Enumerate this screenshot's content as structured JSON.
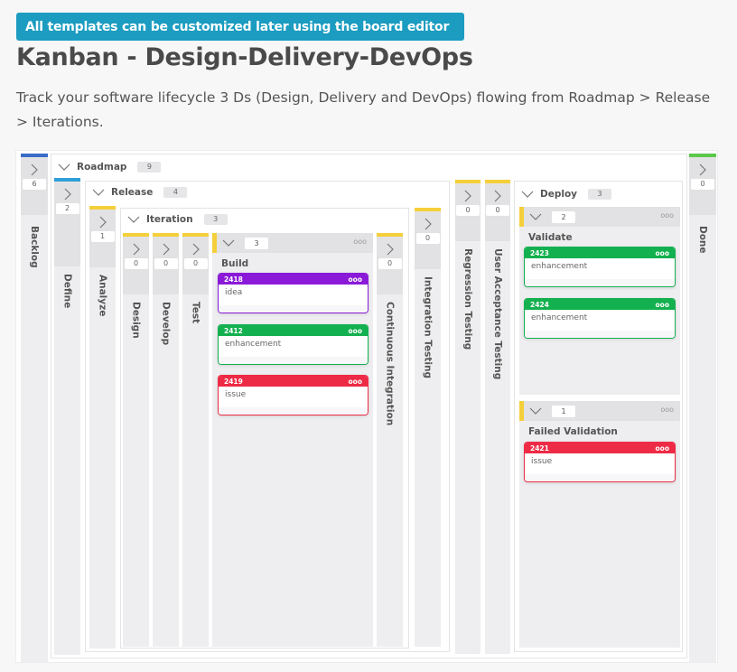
{
  "banner": "All templates can be customized later using the board editor",
  "title": "Kanban - Design-Delivery-DevOps",
  "description": "Track your software lifecycle 3 Ds (Design, Delivery and DevOps) flowing from Roadmap > Release > Iterations.",
  "colors": {
    "backlog_bar": "#3a6bc7",
    "define_bar": "#2f9fd8",
    "inner_bar": "#f5cf3a",
    "done_bar": "#5cc84a",
    "idea": "#8a1ad8",
    "enhancement": "#13b04f",
    "issue": "#ee2b46"
  },
  "board": {
    "backlog": {
      "label": "Backlog",
      "count": "6"
    },
    "roadmap": {
      "label": "Roadmap",
      "count": "9",
      "define": {
        "label": "Define",
        "count": "2"
      },
      "release": {
        "label": "Release",
        "count": "4",
        "analyze": {
          "label": "Analyze",
          "count": "1"
        },
        "iteration": {
          "label": "Iteration",
          "count": "3",
          "design": {
            "label": "Design",
            "count": "0"
          },
          "develop": {
            "label": "Develop",
            "count": "0"
          },
          "test": {
            "label": "Test",
            "count": "0"
          },
          "build": {
            "label": "Build",
            "count": "3",
            "menu": "ooo",
            "cards": [
              {
                "id": "2418",
                "type": "idea",
                "menu": "ooo"
              },
              {
                "id": "2412",
                "type": "enhancement",
                "menu": "ooo"
              },
              {
                "id": "2419",
                "type": "issue",
                "menu": "ooo"
              }
            ]
          },
          "ci": {
            "label": "Continuous Integration",
            "count": "0"
          }
        },
        "integration_testing": {
          "label": "Integration Testing",
          "count": "0"
        }
      },
      "regression_testing": {
        "label": "Regression Testing",
        "count": "0"
      },
      "uat": {
        "label": "User Acceptance Testing",
        "count": "0"
      },
      "deploy": {
        "label": "Deploy",
        "count": "3",
        "validate": {
          "label": "Validate",
          "count": "2",
          "menu": "ooo",
          "cards": [
            {
              "id": "2423",
              "type": "enhancement",
              "menu": "ooo"
            },
            {
              "id": "2424",
              "type": "enhancement",
              "menu": "ooo"
            }
          ]
        },
        "failed_validation": {
          "label": "Failed Validation",
          "count": "1",
          "menu": "ooo",
          "cards": [
            {
              "id": "2421",
              "type": "issue",
              "menu": "ooo"
            }
          ]
        }
      }
    },
    "done": {
      "label": "Done",
      "count": "0"
    }
  }
}
